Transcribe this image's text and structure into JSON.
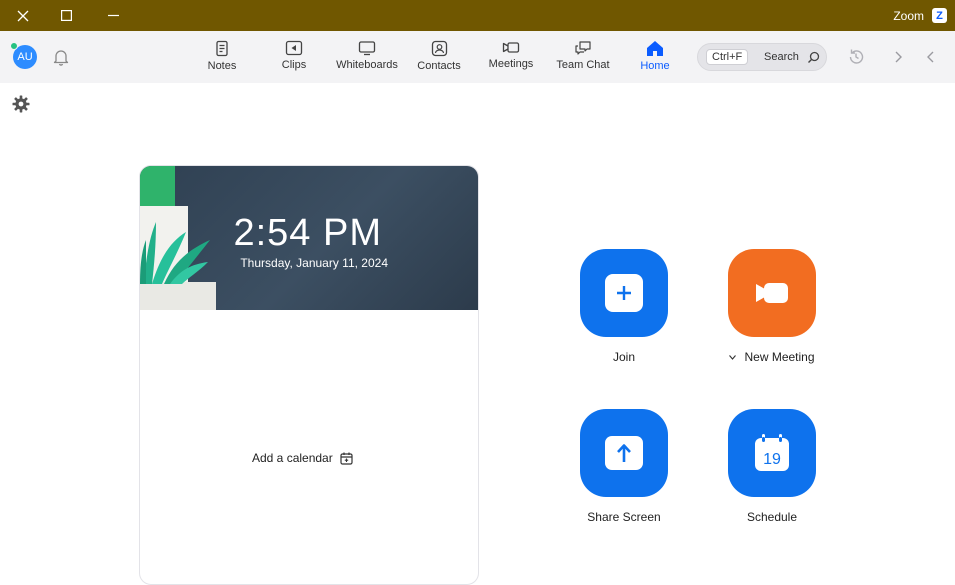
{
  "window": {
    "title": "Zoom",
    "close_icon": "close-icon",
    "maximize_icon": "maximize-icon",
    "minimize_icon": "minimize-icon"
  },
  "toolbar": {
    "avatar_initials": "AU",
    "status_color": "#26c281",
    "search": {
      "label": "Search",
      "shortcut": "Ctrl+F"
    },
    "tabs": [
      {
        "label": "Home",
        "icon": "home-icon",
        "active": true
      },
      {
        "label": "Team Chat",
        "icon": "chat-icon"
      },
      {
        "label": "Meetings",
        "icon": "video-icon"
      },
      {
        "label": "Contacts",
        "icon": "contacts-icon"
      },
      {
        "label": "Whiteboards",
        "icon": "whiteboard-icon"
      },
      {
        "label": "Clips",
        "icon": "clips-icon"
      },
      {
        "label": "Notes",
        "icon": "notes-icon"
      }
    ]
  },
  "clock": {
    "time": "2:54 PM",
    "date": "Thursday, January 11, 2024"
  },
  "calendar": {
    "add_label": "Add a calendar"
  },
  "actions": {
    "new_meeting": {
      "label": "New Meeting",
      "color": "#f26d21"
    },
    "join": {
      "label": "Join",
      "color": "#0e72ed"
    },
    "schedule": {
      "label": "Schedule",
      "color": "#0e72ed",
      "day": "19"
    },
    "share_screen": {
      "label": "Share Screen",
      "color": "#0e72ed"
    }
  },
  "colors": {
    "titlebar": "#705700",
    "accent": "#0b5cff"
  }
}
